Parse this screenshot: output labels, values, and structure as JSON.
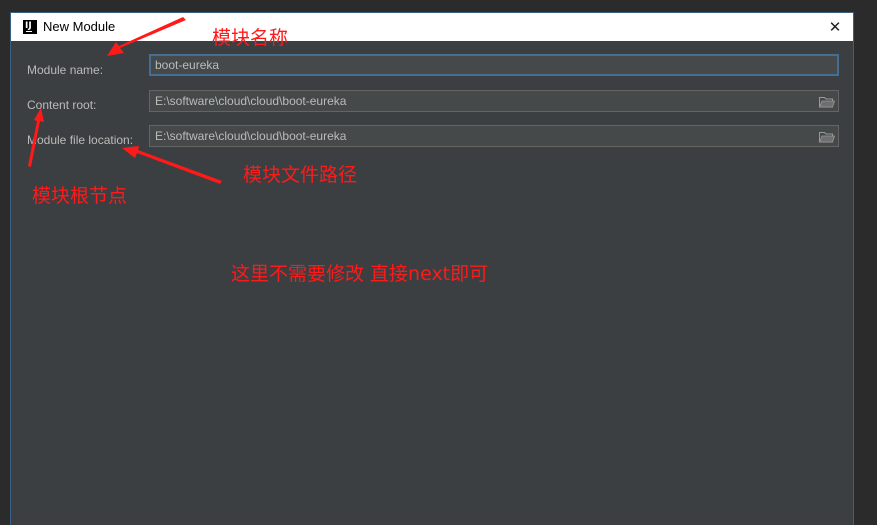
{
  "window": {
    "title": "New Module",
    "app_icon_text": "IJ",
    "close_glyph": "✕"
  },
  "form": {
    "module_name": {
      "label": "Module name:",
      "value": "boot-eureka"
    },
    "content_root": {
      "label": "Content root:",
      "value": "E:\\software\\cloud\\cloud\\boot-eureka",
      "browse_icon": "folder-icon"
    },
    "module_file_location": {
      "label": "Module file location:",
      "value": "E:\\software\\cloud\\cloud\\boot-eureka",
      "browse_icon": "folder-icon"
    }
  },
  "annotations": {
    "module_name_note": "模块名称",
    "content_root_note": "模块根节点",
    "file_location_note": "模块文件路径",
    "next_note": "这里不需要修改 直接next即可"
  },
  "colors": {
    "dialog_bg": "#3c3f41",
    "field_bg": "#45494a",
    "focus_border": "#466d94",
    "annotation_red": "#ff1a1a"
  }
}
